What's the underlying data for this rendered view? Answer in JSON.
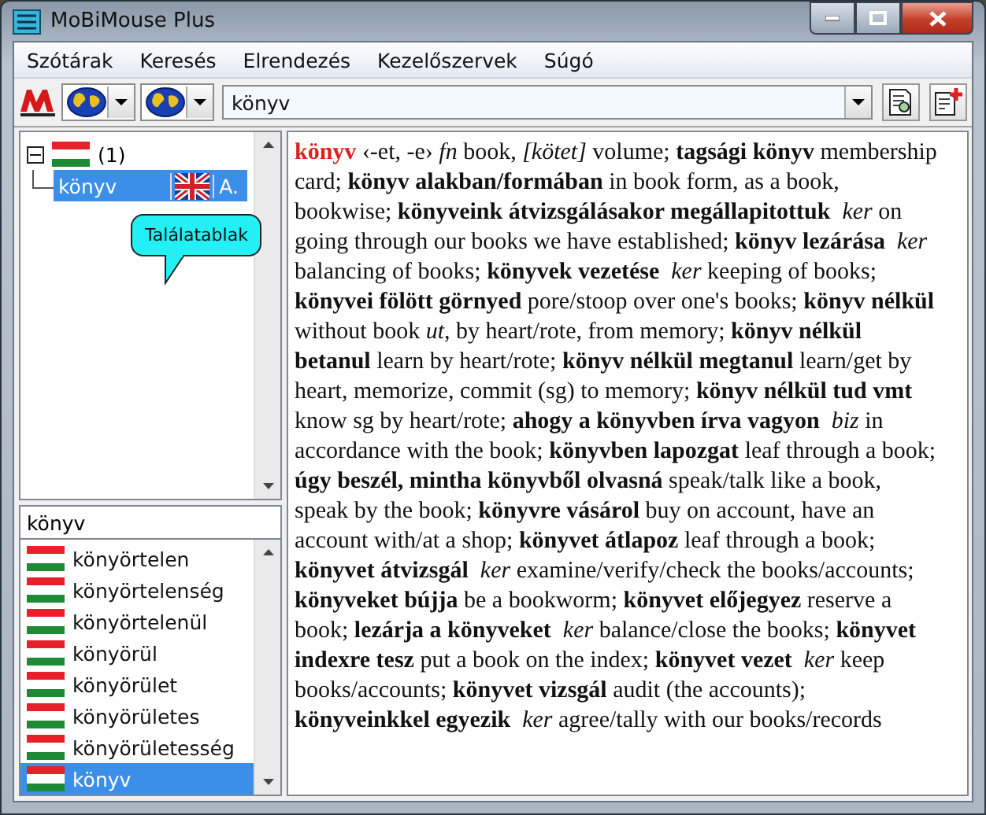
{
  "window": {
    "title": "MoBiMouse Plus"
  },
  "menu": [
    "Szótárak",
    "Keresés",
    "Elrendezés",
    "Kezelőszervek",
    "Súgó"
  ],
  "toolbar": {
    "search": {
      "value": "könyv"
    }
  },
  "tree": {
    "expanded": true,
    "label": "(1)",
    "children": [
      {
        "label": "könyv",
        "extra": "A.",
        "selected": true
      }
    ]
  },
  "tooltip": {
    "text": "Találatablak"
  },
  "word_search": {
    "value": "könyv"
  },
  "word_list": [
    {
      "label": "könyörtelen",
      "selected": false
    },
    {
      "label": "könyörtelenség",
      "selected": false
    },
    {
      "label": "könyörtelenül",
      "selected": false
    },
    {
      "label": "könyörül",
      "selected": false
    },
    {
      "label": "könyörület",
      "selected": false
    },
    {
      "label": "könyörületes",
      "selected": false
    },
    {
      "label": "könyörületesség",
      "selected": false
    },
    {
      "label": "könyv",
      "selected": true
    }
  ],
  "entry": {
    "headword": "könyv",
    "text": "‹-et, -e› *fn* book, *[kötet]* volume; **tagsági könyv** membership card; **könyv alakban/formában** in book form, as a book, bookwise; **könyveink átvizsgálásakor megállapitottuk**  *ker* on going through our books we have established; **könyv lezárása**  *ker* balancing of books; **könyvek vezetése**  *ker* keeping of books; **könyvei fölött görnyed** pore/stoop over one's books; **könyv nélkül** without book *ut*, by heart/rote, from memory; **könyv nélkül betanul** learn by heart/rote; **könyv nélkül megtanul** learn/get by heart, memorize, commit (sg) to memory; **könyv nélkül tud vmt** know sg by heart/rote; **ahogy a könyvben írva vagyon**  *biz* in accordance with the book; **könyvben lapozgat** leaf through a book; **úgy beszél, mintha könyvből olvasná** speak/talk like a book, speak by the book; **könyvre vásárol** buy on account, have an account with/at a shop; **könyvet átlapoz** leaf through a book; **könyvet átvizsgál**  *ker* examine/verify/check the books/accounts; **könyveket bújja** be a bookworm; **könyvet előjegyez** reserve a book; **lezárja a könyveket**  *ker* balance/close the books; **könyvet indexre tesz** put a book on the index; **könyvet vezet**  *ker* keep books/accounts; **könyvet vizsgál** audit (the accounts); **könyveinkkel egyezik**  *ker* agree/tally with our books/records"
  }
}
